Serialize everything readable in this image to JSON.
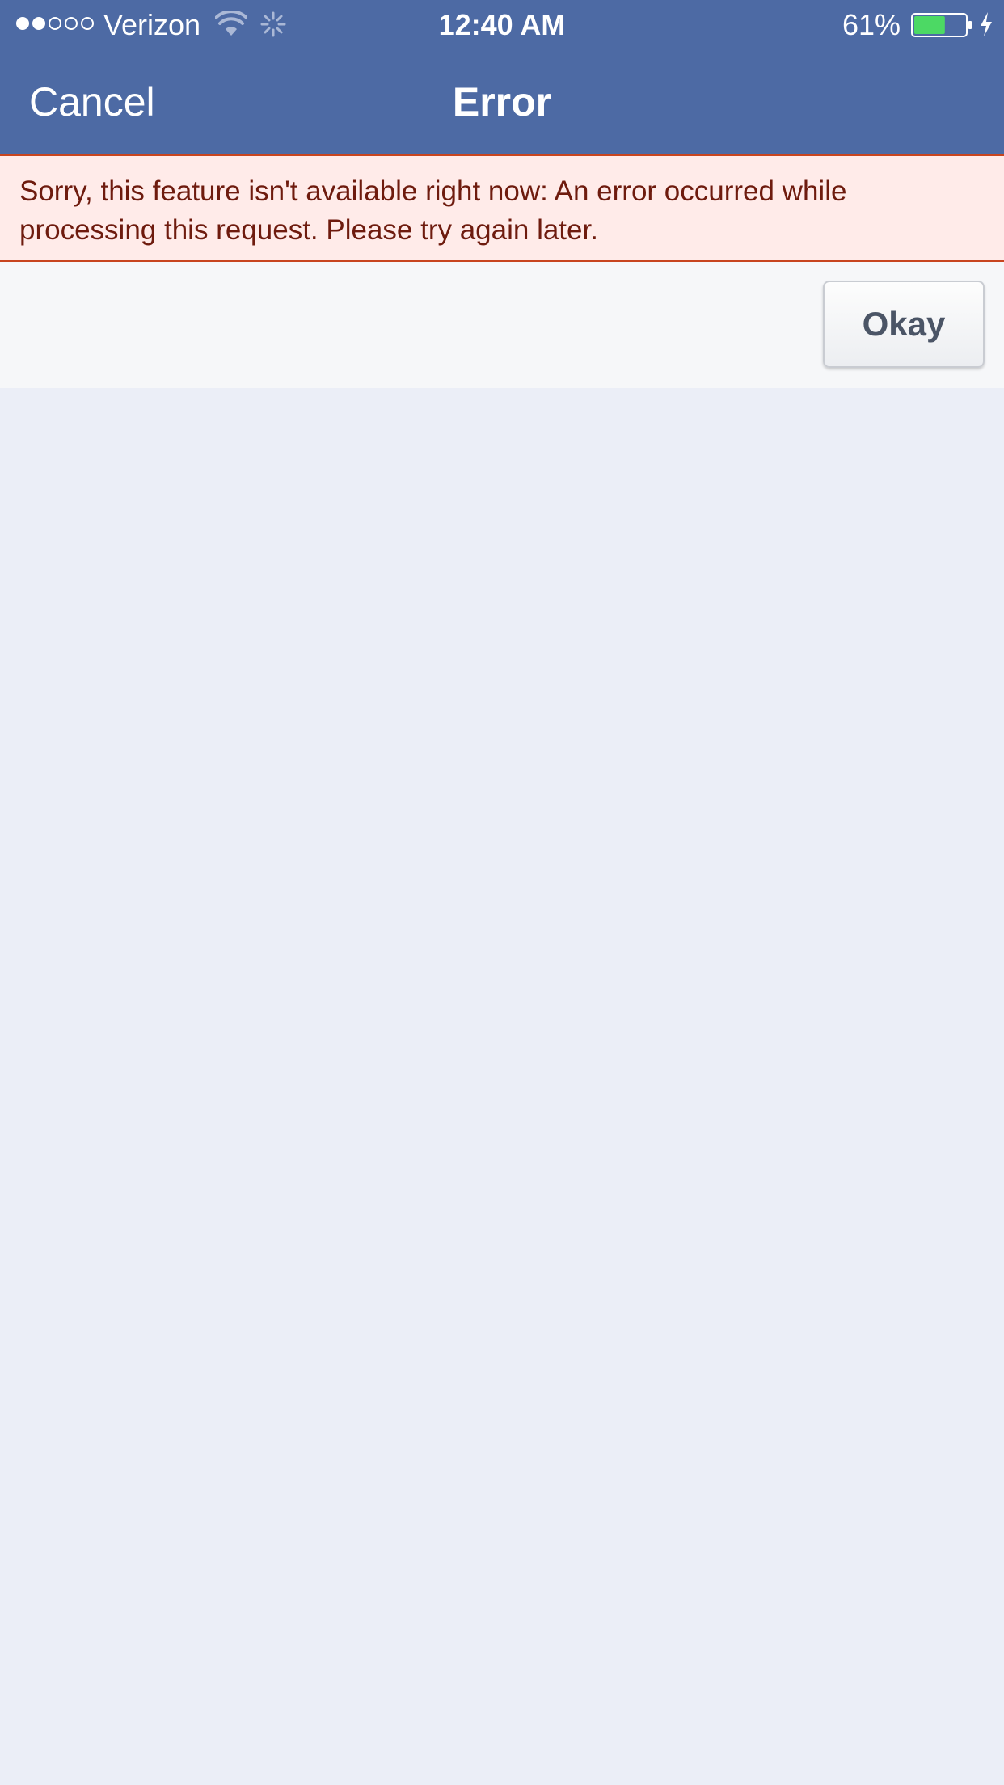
{
  "status_bar": {
    "signal_bars_filled": 2,
    "signal_bars_total": 5,
    "carrier": "Verizon",
    "wifi_icon": "wifi-icon",
    "activity_icon": "activity-spinner-icon",
    "time": "12:40 AM",
    "battery_percent": "61%",
    "battery_level": 0.61,
    "charging_icon": "lightning-bolt-icon"
  },
  "nav": {
    "cancel_label": "Cancel",
    "title": "Error"
  },
  "error": {
    "message": "Sorry, this feature isn't available right now: An error occurred while processing this request. Please try again later."
  },
  "actions": {
    "okay_label": "Okay"
  },
  "colors": {
    "nav_background": "#4d6aa4",
    "error_background": "#ffebe9",
    "error_border": "#c8451f",
    "error_text": "#6e1b0e",
    "page_background": "#ebeef7",
    "battery_fill": "#4cd964"
  }
}
